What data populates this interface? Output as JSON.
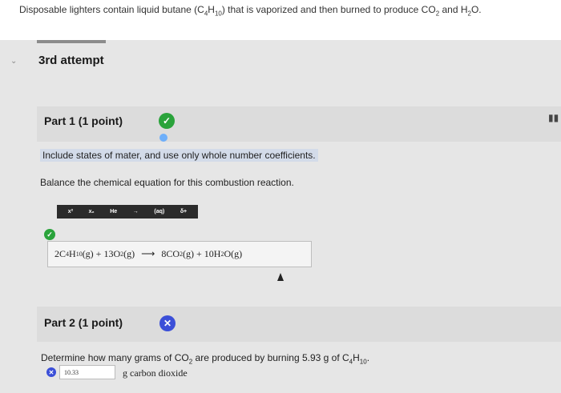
{
  "question": {
    "prefix": "Disposable lighters contain liquid butane (C",
    "c_sub": "4",
    "h": "H",
    "h_sub": "10",
    "middle": ") that is vaporized and then burned to produce CO",
    "co2_sub": "2",
    "and": " and H",
    "h2o_sub": "2",
    "suffix": "O."
  },
  "attempt": {
    "title": "3rd attempt",
    "chevron": "⌄"
  },
  "part1": {
    "label": "Part 1   (1 point)",
    "status_icon": "check-icon",
    "instruction": "Include states of mater, and use only whole number coefficients.",
    "balance": "Balance the chemical equation for this combustion reaction.",
    "toolbar": [
      "x²",
      "x₂",
      "He",
      "→",
      "(aq)",
      "δ+"
    ],
    "equation": {
      "t1": "2C",
      "s1": "4",
      "t2": "H",
      "s2": "10",
      "t3": "(g) + 13O",
      "s3": "2",
      "t4": "(g)",
      "arrow": "⟶",
      "t5": "8CO",
      "s5": "2",
      "t6": "(g) + 10H",
      "s6": "2",
      "t7": "O(g)"
    }
  },
  "part2": {
    "label": "Part 2   (1 point)",
    "status_icon": "x-icon",
    "determine": {
      "prefix": "Determine how many grams of CO",
      "sub": "2",
      "middle": " are produced by burning 5.93 g of C",
      "c_sub": "4",
      "h": "H",
      "h_sub": "10",
      "suffix": "."
    },
    "answer_value": "10.33",
    "unit": "g carbon dioxide"
  },
  "colors": {
    "correct": "#2aa33b",
    "incorrect": "#3b4fd8",
    "highlight": "#d3dbe9"
  }
}
